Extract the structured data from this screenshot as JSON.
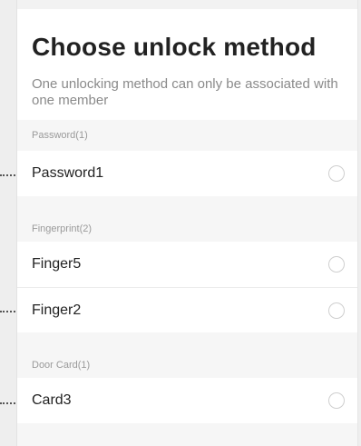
{
  "header": {
    "title": "Choose unlock method",
    "subtitle": "One unlocking method can only be associated with one member"
  },
  "sections": [
    {
      "label": "Password(1)",
      "items": [
        {
          "label": "Password1"
        }
      ]
    },
    {
      "label": "Fingerprint(2)",
      "items": [
        {
          "label": "Finger5"
        },
        {
          "label": "Finger2"
        }
      ]
    },
    {
      "label": "Door Card(1)",
      "items": [
        {
          "label": "Card3"
        }
      ]
    }
  ],
  "colors": {
    "background": "#f6f6f6",
    "row_background": "#ffffff",
    "radio_border": "#cfcfcf",
    "text_primary": "#222222",
    "text_secondary": "#8a8a8a"
  },
  "icons": [
    "radio-unchecked-icon"
  ]
}
